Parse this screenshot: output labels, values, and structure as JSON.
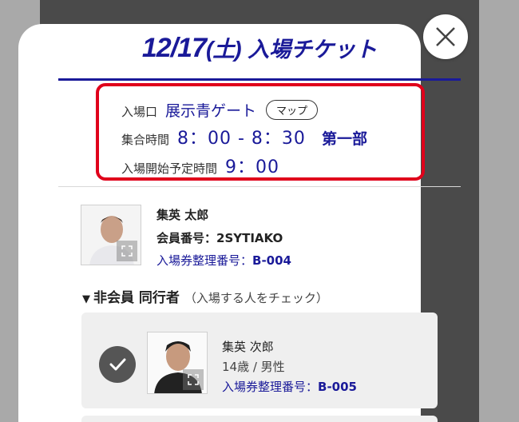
{
  "header": {
    "date_main": "12/17",
    "date_paren": "(土)",
    "title_suffix": "入場チケット"
  },
  "close": {
    "icon": "close-icon"
  },
  "entry": {
    "gate_label": "入場口",
    "gate_value": "展示青ゲート",
    "map_button": "マップ",
    "meet_label": "集合時間",
    "meet_value": "8：00 - 8：30",
    "meet_part": "第一部",
    "start_label": "入場開始予定時間",
    "start_value": "9：00"
  },
  "member": {
    "name": "集英 太郎",
    "member_no_label": "会員番号：",
    "member_no": "2SYTIAKO",
    "ticket_label": "入場券整理番号：",
    "ticket_no": "B-004",
    "expand_icon": "expand-icon"
  },
  "companions": {
    "heading": "非会員 同行者",
    "note": "（入場する人をチェック）",
    "items": [
      {
        "name": "集英 次郎",
        "detail": "14歳 / 男性",
        "ticket_label": "入場券整理番号：",
        "ticket_no": "B-005",
        "checked": true
      }
    ]
  },
  "colors": {
    "accent": "#1a1a99",
    "highlight": "#e0001b",
    "check": "#555555"
  }
}
